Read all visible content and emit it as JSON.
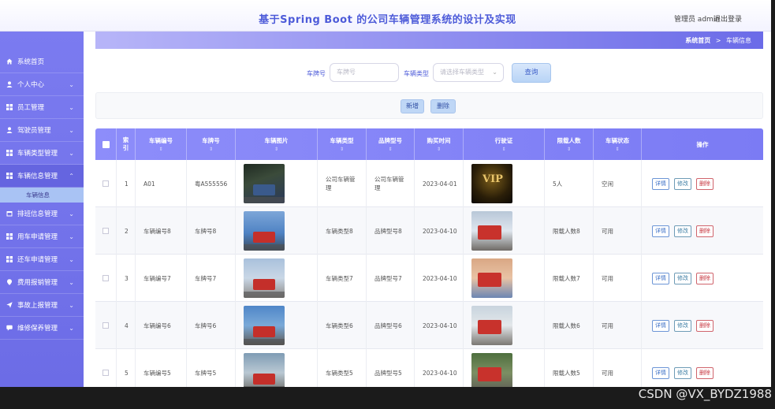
{
  "header": {
    "title": "基于Spring Boot 的公司车辆管理系统的设计及实现",
    "user": "管理员 admin",
    "logout": "退出登录"
  },
  "sidebar": {
    "items": [
      {
        "label": "系统首页",
        "icon": "home-icon"
      },
      {
        "label": "个人中心",
        "icon": "user-icon"
      },
      {
        "label": "员工管理",
        "icon": "grid-icon"
      },
      {
        "label": "驾驶员管理",
        "icon": "user-icon"
      },
      {
        "label": "车辆类型管理",
        "icon": "grid-icon"
      },
      {
        "label": "车辆信息管理",
        "icon": "grid-icon"
      },
      {
        "label": "排班信息管理",
        "icon": "calendar-icon"
      },
      {
        "label": "用车申请管理",
        "icon": "grid-icon"
      },
      {
        "label": "还车申请管理",
        "icon": "grid-icon"
      },
      {
        "label": "费用报销管理",
        "icon": "pin-icon"
      },
      {
        "label": "事故上报管理",
        "icon": "send-icon"
      },
      {
        "label": "维修保养管理",
        "icon": "chat-icon"
      }
    ],
    "submenu": "车辆信息"
  },
  "breadcrumb": {
    "home": "系统首页",
    "sep": ">",
    "current": "车辆信息"
  },
  "search": {
    "plate_label": "车牌号",
    "plate_placeholder": "车牌号",
    "type_label": "车辆类型",
    "type_placeholder": "请选择车辆类型",
    "query_button": "查询"
  },
  "actions": {
    "add": "新增",
    "delete": "删除"
  },
  "table": {
    "headers": {
      "index": "索引",
      "code": "车辆编号",
      "plate": "车牌号",
      "photo": "车辆图片",
      "type": "车辆类型",
      "brand": "品牌型号",
      "date": "购买时间",
      "license": "行驶证",
      "seats": "限载人数",
      "status": "车辆状态",
      "ops": "操作"
    },
    "sort_mark": "⇕",
    "op_labels": {
      "view": "详情",
      "edit": "修改",
      "del": "删除"
    },
    "rows": [
      {
        "index": "1",
        "code": "A01",
        "plate": "粤A555556",
        "type": "公司车辆管理",
        "brand": "公司车辆管理",
        "date": "2023-04-01",
        "seats": "5人",
        "status": "空闲"
      },
      {
        "index": "2",
        "code": "车辆编号8",
        "plate": "车牌号8",
        "type": "车辆类型8",
        "brand": "品牌型号8",
        "date": "2023-04-10",
        "seats": "限载人数8",
        "status": "可用"
      },
      {
        "index": "3",
        "code": "车辆编号7",
        "plate": "车牌号7",
        "type": "车辆类型7",
        "brand": "品牌型号7",
        "date": "2023-04-10",
        "seats": "限载人数7",
        "status": "可用"
      },
      {
        "index": "4",
        "code": "车辆编号6",
        "plate": "车牌号6",
        "type": "车辆类型6",
        "brand": "品牌型号6",
        "date": "2023-04-10",
        "seats": "限载人数6",
        "status": "可用"
      },
      {
        "index": "5",
        "code": "车辆编号5",
        "plate": "车牌号5",
        "type": "车辆类型5",
        "brand": "品牌型号5",
        "date": "2023-04-10",
        "seats": "限载人数5",
        "status": "可用"
      }
    ]
  },
  "watermark": "CSDN @VX_BYDZ1988",
  "colors": {
    "accent": "#7b7bf4",
    "title": "#4d5bd9",
    "danger": "#c7363f"
  }
}
